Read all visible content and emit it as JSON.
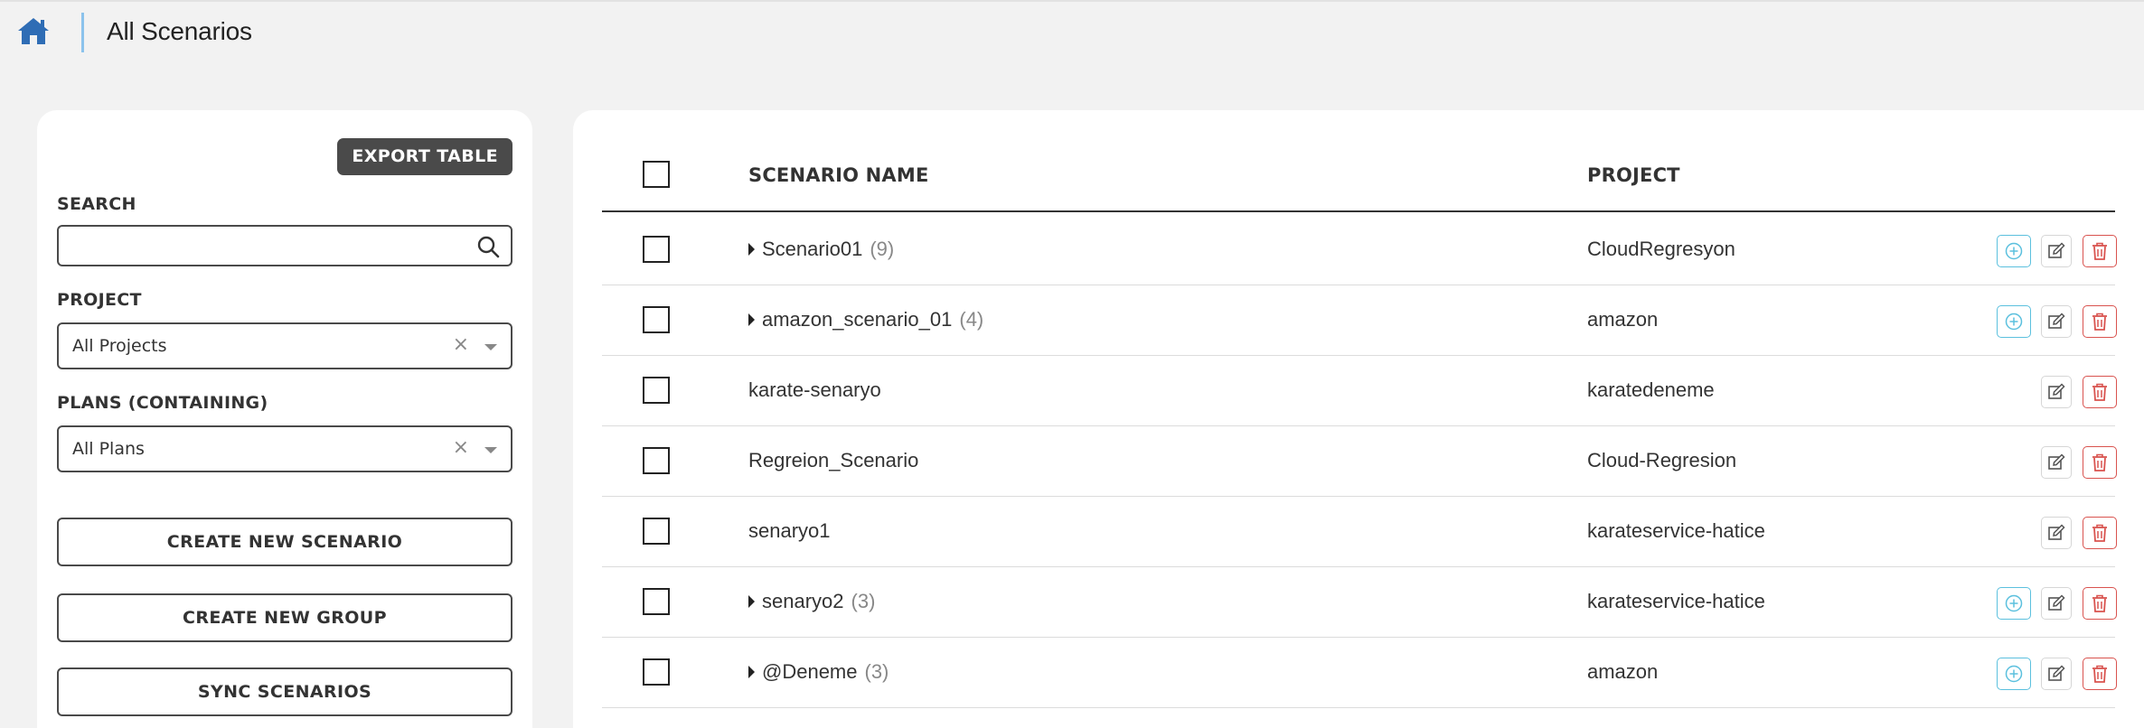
{
  "header": {
    "title": "All Scenarios"
  },
  "sidebar": {
    "export_label": "EXPORT TABLE",
    "search": {
      "label": "SEARCH",
      "value": "",
      "placeholder": ""
    },
    "project": {
      "label": "PROJECT",
      "selected": "All Projects",
      "clear": "×"
    },
    "plans": {
      "label": "PLANS (CONTAINING)",
      "selected": "All Plans",
      "clear": "×"
    },
    "buttons": {
      "create_scenario": "CREATE NEW SCENARIO",
      "create_group": "CREATE NEW GROUP",
      "sync": "SYNC SCENARIOS"
    }
  },
  "table": {
    "columns": {
      "name": "SCENARIO NAME",
      "project": "PROJECT"
    },
    "rows": [
      {
        "name": "Scenario01",
        "count": "(9)",
        "project": "CloudRegresyon",
        "expandable": true
      },
      {
        "name": "amazon_scenario_01",
        "count": "(4)",
        "project": "amazon",
        "expandable": true
      },
      {
        "name": "karate-senaryo",
        "count": "",
        "project": "karatedeneme",
        "expandable": false
      },
      {
        "name": "Regreion_Scenario",
        "count": "",
        "project": "Cloud-Regresion",
        "expandable": false
      },
      {
        "name": "senaryo1",
        "count": "",
        "project": "karateservice-hatice",
        "expandable": false
      },
      {
        "name": "senaryo2",
        "count": "(3)",
        "project": "karateservice-hatice",
        "expandable": true
      },
      {
        "name": "@Deneme",
        "count": "(3)",
        "project": "amazon",
        "expandable": true
      }
    ]
  },
  "icons": {
    "home": "home-icon",
    "search": "search-icon",
    "add": "plus-circle-icon",
    "edit": "edit-icon",
    "delete": "trash-icon"
  },
  "colors": {
    "home": "#2f6db5",
    "divider": "#8cc3ec",
    "add": "#5bc0de",
    "delete": "#d9534f",
    "dark": "#4a4a4a"
  }
}
